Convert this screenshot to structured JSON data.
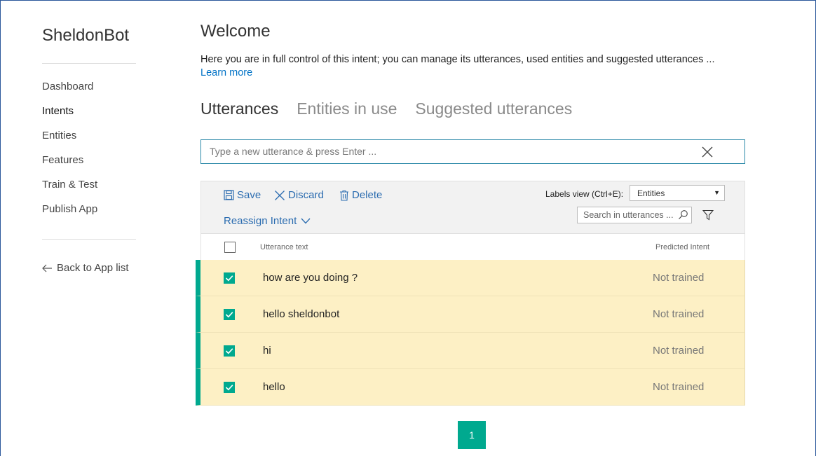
{
  "app": {
    "name": "SheldonBot"
  },
  "sidebar": {
    "items": [
      {
        "label": "Dashboard"
      },
      {
        "label": "Intents"
      },
      {
        "label": "Entities"
      },
      {
        "label": "Features"
      },
      {
        "label": "Train & Test"
      },
      {
        "label": "Publish App"
      }
    ],
    "active": "Intents",
    "back_label": "Back to App list"
  },
  "header": {
    "title": "Welcome",
    "description": "Here you are in full control of this intent; you can manage its utterances, used entities and suggested utterances ...",
    "learn_more": "Learn more"
  },
  "tabs": [
    {
      "label": "Utterances",
      "active": true
    },
    {
      "label": "Entities in use",
      "active": false
    },
    {
      "label": "Suggested utterances",
      "active": false
    }
  ],
  "utterance_input": {
    "placeholder": "Type a new utterance & press Enter ...",
    "value": ""
  },
  "toolbar": {
    "save_label": "Save",
    "discard_label": "Discard",
    "delete_label": "Delete",
    "reassign_label": "Reassign Intent",
    "labels_view_label": "Labels view (Ctrl+E):",
    "labels_view_value": "Entities",
    "search_placeholder": "Search in utterances ..."
  },
  "table": {
    "columns": {
      "text": "Utterance text",
      "intent": "Predicted Intent"
    },
    "rows": [
      {
        "text": "how are you doing ?",
        "intent": "Not trained",
        "checked": true
      },
      {
        "text": "hello sheldonbot",
        "intent": "Not trained",
        "checked": true
      },
      {
        "text": "hi",
        "intent": "Not trained",
        "checked": true
      },
      {
        "text": "hello",
        "intent": "Not trained",
        "checked": true
      }
    ]
  },
  "pagination": {
    "current": "1"
  },
  "colors": {
    "accent": "#00a98f",
    "link": "#2b6cb0",
    "row_selected": "#fdf0c5",
    "input_border": "#2b88a8"
  }
}
